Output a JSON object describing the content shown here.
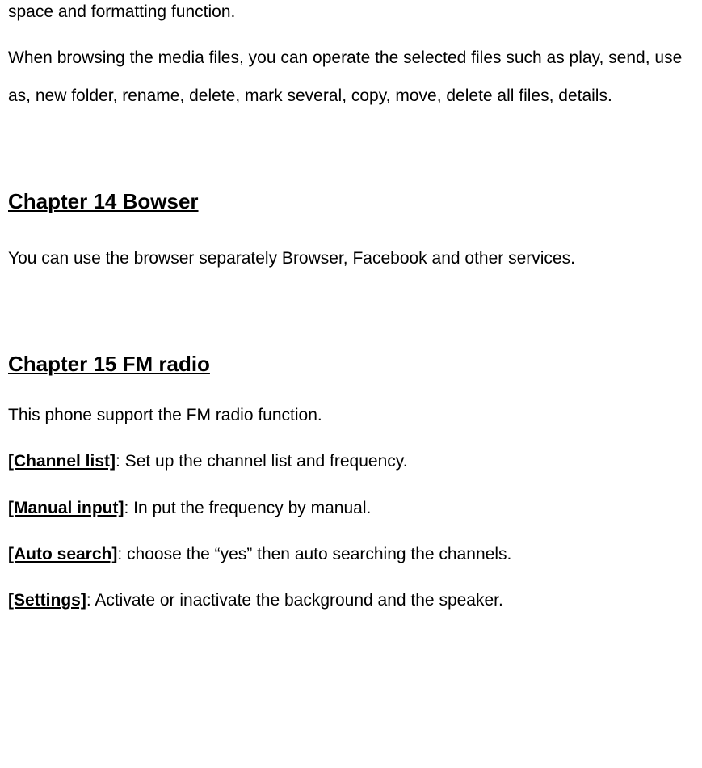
{
  "intro": {
    "fragment": "space and formatting function.",
    "media_files": "When browsing the media files, you can operate the selected files such as play, send, use as, new folder, rename, delete, mark several, copy, move, delete all files, details."
  },
  "chapter14": {
    "title": "Chapter 14 Bowser",
    "body": "You can use the browser separately Browser, Facebook and other services."
  },
  "chapter15": {
    "title": "Chapter 15 FM radio",
    "intro": "This phone support the FM radio function.",
    "items": [
      {
        "label": "[Channel list]",
        "text": ": Set up the channel list and frequency."
      },
      {
        "label": "[Manual input]",
        "text": ": In put the frequency by manual."
      },
      {
        "label": "[Auto search]",
        "text": ": choose the  “yes”  then auto searching the channels."
      },
      {
        "label": "[Settings]",
        "text": ": Activate or inactivate the background and the speaker."
      }
    ]
  }
}
